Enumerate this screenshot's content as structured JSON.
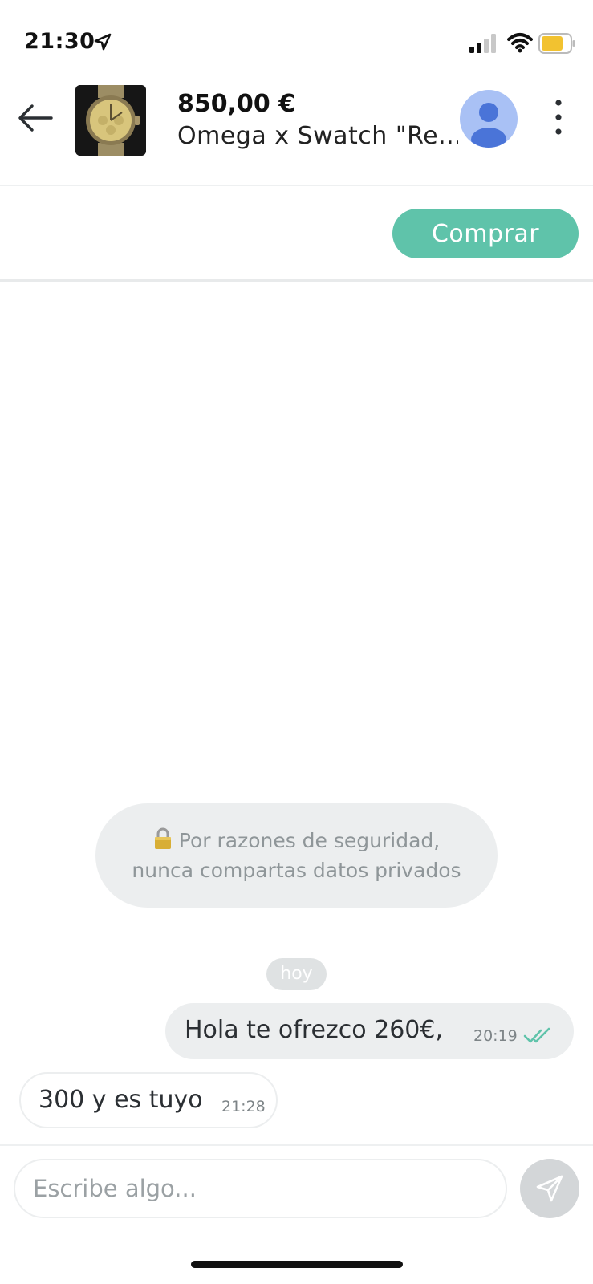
{
  "status_bar": {
    "time": "21:30",
    "icons": [
      "location-arrow-icon",
      "cellular-signal-icon",
      "wifi-icon",
      "battery-icon"
    ]
  },
  "header": {
    "price": "850,00 €",
    "title": "Omega x Swatch \"Re...",
    "icons": [
      "back-arrow-icon",
      "product-thumbnail",
      "seller-avatar",
      "more-vertical-icon"
    ]
  },
  "buy_button": {
    "label": "Comprar"
  },
  "chat": {
    "security_notice": "Por razones de seguridad, nunca compartas datos privados",
    "day_label": "hoy",
    "messages": [
      {
        "direction": "outgoing",
        "text": "Hola te ofrezco 260€,",
        "time": "20:19",
        "status": "read"
      },
      {
        "direction": "incoming",
        "text": "300 y es tuyo",
        "time": "21:28"
      }
    ]
  },
  "composer": {
    "placeholder": "Escribe algo...",
    "send_icon": "send-icon"
  },
  "colors": {
    "accent": "#5fc3aa",
    "read_check": "#5fc3aa",
    "bubble": "#eceeef",
    "avatar": "#a9c1f5"
  }
}
